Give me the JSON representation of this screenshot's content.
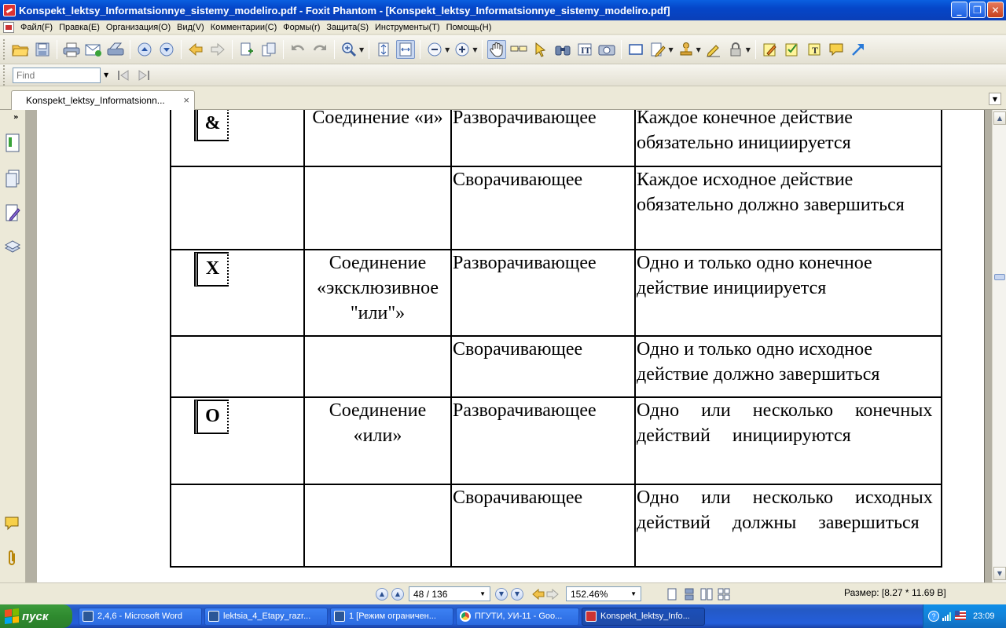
{
  "window": {
    "title": "Konspekt_lektsy_Informatsionnye_sistemy_modeliro.pdf - Foxit Phantom - [Konspekt_lektsy_Informatsionnye_sistemy_modeliro.pdf]",
    "minimize": "_",
    "restore": "❐",
    "close": "✕"
  },
  "menu": {
    "items": [
      "Файл(F)",
      "Правка(E)",
      "Организация(O)",
      "Вид(V)",
      "Комментарии(C)",
      "Формы(r)",
      "Защита(S)",
      "Инструменты(T)",
      "Помощь(H)"
    ]
  },
  "find": {
    "placeholder": "Find"
  },
  "tab": {
    "label": "Konspekt_lektsy_Informatsionn...",
    "close": "×"
  },
  "table": {
    "rows": [
      {
        "symbol": "&",
        "name": "Соединение «и»",
        "type": "Разворачивающее",
        "desc": "Каждое конечное действие обязательно инициируется"
      },
      {
        "symbol": "",
        "name": "",
        "type": "Сворачивающее",
        "desc": "Каждое исходное действие обязательно должно завершиться"
      },
      {
        "symbol": "X",
        "name": "Соединение «эксклюзивное \"или\"»",
        "type": "Разворачивающее",
        "desc": "Одно и только одно конечное действие инициируется"
      },
      {
        "symbol": "",
        "name": "",
        "type": "Сворачивающее",
        "desc": "Одно и только одно исходное действие должно завершиться"
      },
      {
        "symbol": "O",
        "name": "Соединение «или»",
        "type": "Разворачивающее",
        "desc": "Одно или несколько конечных действий инициируются"
      },
      {
        "symbol": "",
        "name": "",
        "type": "Сворачивающее",
        "desc": "Одно или несколько исходных действий должны завершиться"
      }
    ]
  },
  "status": {
    "page": "48 / 136",
    "zoom": "152.46%",
    "size": "Размер: [8.27 * 11.69 В]"
  },
  "taskbar": {
    "start": "пуск",
    "tasks": [
      {
        "label": "2,4,6 - Microsoft Word",
        "icon_color": "#2b5797"
      },
      {
        "label": "lektsia_4_Etapy_razr...",
        "icon_color": "#2b5797"
      },
      {
        "label": "1 [Режим ограничен...",
        "icon_color": "#2b5797"
      },
      {
        "label": "ПГУТИ, УИ-11 - Goo...",
        "icon_color": "#dd4b39"
      },
      {
        "label": "Konspekt_lektsy_Info...",
        "icon_color": "#cc3333"
      }
    ],
    "clock": "23:09"
  },
  "colors": {
    "titlebar": "#0546c8",
    "chrome": "#ece9d8",
    "doc_background": "#b3b0a3",
    "taskbar": "#245edb",
    "start_button": "#2f8a2f"
  }
}
